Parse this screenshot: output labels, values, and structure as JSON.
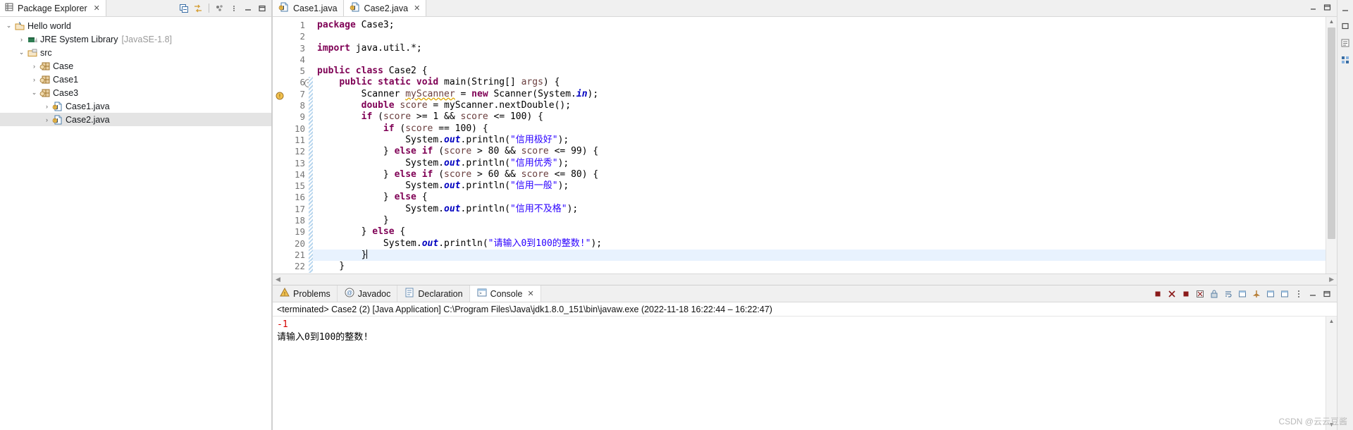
{
  "package_explorer": {
    "tab_label": "Package Explorer",
    "tab_close": "✕",
    "toolbar": {
      "collapse_all": "collapse-all-icon",
      "link_with_editor": "link-with-editor-icon",
      "view_menu": "view-menu-icon",
      "minimize": "minimize-icon",
      "maximize": "maximize-icon"
    },
    "tree": [
      {
        "label": "Hello world",
        "dim": "",
        "indent": 0,
        "twisty": "v",
        "icon": "java-project-icon",
        "selected": false
      },
      {
        "label": "JRE System Library",
        "dim": "[JavaSE-1.8]",
        "indent": 1,
        "twisty": ">",
        "icon": "library-icon",
        "selected": false
      },
      {
        "label": "src",
        "dim": "",
        "indent": 1,
        "twisty": "v",
        "icon": "source-folder-icon",
        "selected": false
      },
      {
        "label": "Case",
        "dim": "",
        "indent": 2,
        "twisty": ">",
        "icon": "package-icon",
        "selected": false
      },
      {
        "label": "Case1",
        "dim": "",
        "indent": 2,
        "twisty": ">",
        "icon": "package-icon",
        "selected": false
      },
      {
        "label": "Case3",
        "dim": "",
        "indent": 2,
        "twisty": "v",
        "icon": "package-icon",
        "selected": false
      },
      {
        "label": "Case1.java",
        "dim": "",
        "indent": 3,
        "twisty": ">",
        "icon": "java-file-icon",
        "selected": false
      },
      {
        "label": "Case2.java",
        "dim": "",
        "indent": 3,
        "twisty": ">",
        "icon": "java-file-icon",
        "selected": true
      }
    ]
  },
  "editor": {
    "tabs": [
      {
        "label": "Case1.java",
        "active": false,
        "close": ""
      },
      {
        "label": "Case2.java",
        "active": true,
        "close": "✕"
      }
    ],
    "lines": [
      {
        "n": 1,
        "fold": false,
        "mark": "",
        "changed": false,
        "highlight": false,
        "tokens": [
          {
            "t": "package ",
            "c": "kw"
          },
          {
            "t": "Case3;",
            "c": "plain"
          }
        ]
      },
      {
        "n": 2,
        "fold": false,
        "mark": "",
        "changed": false,
        "highlight": false,
        "tokens": []
      },
      {
        "n": 3,
        "fold": false,
        "mark": "",
        "changed": false,
        "highlight": false,
        "tokens": [
          {
            "t": "import ",
            "c": "kw"
          },
          {
            "t": "java.util.*;",
            "c": "plain"
          }
        ]
      },
      {
        "n": 4,
        "fold": false,
        "mark": "",
        "changed": false,
        "highlight": false,
        "tokens": []
      },
      {
        "n": 5,
        "fold": false,
        "mark": "",
        "changed": false,
        "highlight": false,
        "tokens": [
          {
            "t": "public class ",
            "c": "kw"
          },
          {
            "t": "Case2 {",
            "c": "plain"
          }
        ]
      },
      {
        "n": 6,
        "fold": true,
        "mark": "",
        "changed": true,
        "highlight": false,
        "tokens": [
          {
            "t": "    ",
            "c": "plain"
          },
          {
            "t": "public static void ",
            "c": "kw"
          },
          {
            "t": "main(String[] ",
            "c": "plain"
          },
          {
            "t": "args",
            "c": "loc"
          },
          {
            "t": ") {",
            "c": "plain"
          }
        ]
      },
      {
        "n": 7,
        "fold": false,
        "mark": "warning",
        "changed": true,
        "highlight": false,
        "tokens": [
          {
            "t": "        Scanner ",
            "c": "plain"
          },
          {
            "t": "myScanner",
            "c": "warnvar"
          },
          {
            "t": " = ",
            "c": "plain"
          },
          {
            "t": "new ",
            "c": "kw"
          },
          {
            "t": "Scanner(System.",
            "c": "plain"
          },
          {
            "t": "in",
            "c": "fld"
          },
          {
            "t": ");",
            "c": "plain"
          }
        ]
      },
      {
        "n": 8,
        "fold": false,
        "mark": "",
        "changed": true,
        "highlight": false,
        "tokens": [
          {
            "t": "        ",
            "c": "plain"
          },
          {
            "t": "double ",
            "c": "kw"
          },
          {
            "t": "score",
            "c": "loc"
          },
          {
            "t": " = myScanner.nextDouble();",
            "c": "plain"
          }
        ]
      },
      {
        "n": 9,
        "fold": false,
        "mark": "",
        "changed": true,
        "highlight": false,
        "tokens": [
          {
            "t": "        ",
            "c": "plain"
          },
          {
            "t": "if ",
            "c": "kw"
          },
          {
            "t": "(",
            "c": "plain"
          },
          {
            "t": "score",
            "c": "loc"
          },
          {
            "t": " >= 1 && ",
            "c": "plain"
          },
          {
            "t": "score",
            "c": "loc"
          },
          {
            "t": " <= 100) {",
            "c": "plain"
          }
        ]
      },
      {
        "n": 10,
        "fold": false,
        "mark": "",
        "changed": true,
        "highlight": false,
        "tokens": [
          {
            "t": "            ",
            "c": "plain"
          },
          {
            "t": "if ",
            "c": "kw"
          },
          {
            "t": "(",
            "c": "plain"
          },
          {
            "t": "score",
            "c": "loc"
          },
          {
            "t": " == 100) {",
            "c": "plain"
          }
        ]
      },
      {
        "n": 11,
        "fold": false,
        "mark": "",
        "changed": true,
        "highlight": false,
        "tokens": [
          {
            "t": "                System.",
            "c": "plain"
          },
          {
            "t": "out",
            "c": "fld"
          },
          {
            "t": ".println(",
            "c": "plain"
          },
          {
            "t": "\"信用极好\"",
            "c": "str"
          },
          {
            "t": ");",
            "c": "plain"
          }
        ]
      },
      {
        "n": 12,
        "fold": false,
        "mark": "",
        "changed": true,
        "highlight": false,
        "tokens": [
          {
            "t": "            } ",
            "c": "plain"
          },
          {
            "t": "else if ",
            "c": "kw"
          },
          {
            "t": "(",
            "c": "plain"
          },
          {
            "t": "score",
            "c": "loc"
          },
          {
            "t": " > 80 && ",
            "c": "plain"
          },
          {
            "t": "score",
            "c": "loc"
          },
          {
            "t": " <= 99) {",
            "c": "plain"
          }
        ]
      },
      {
        "n": 13,
        "fold": false,
        "mark": "",
        "changed": true,
        "highlight": false,
        "tokens": [
          {
            "t": "                System.",
            "c": "plain"
          },
          {
            "t": "out",
            "c": "fld"
          },
          {
            "t": ".println(",
            "c": "plain"
          },
          {
            "t": "\"信用优秀\"",
            "c": "str"
          },
          {
            "t": ");",
            "c": "plain"
          }
        ]
      },
      {
        "n": 14,
        "fold": false,
        "mark": "",
        "changed": true,
        "highlight": false,
        "tokens": [
          {
            "t": "            } ",
            "c": "plain"
          },
          {
            "t": "else if ",
            "c": "kw"
          },
          {
            "t": "(",
            "c": "plain"
          },
          {
            "t": "score",
            "c": "loc"
          },
          {
            "t": " > 60 && ",
            "c": "plain"
          },
          {
            "t": "score",
            "c": "loc"
          },
          {
            "t": " <= 80) {",
            "c": "plain"
          }
        ]
      },
      {
        "n": 15,
        "fold": false,
        "mark": "",
        "changed": true,
        "highlight": false,
        "tokens": [
          {
            "t": "                System.",
            "c": "plain"
          },
          {
            "t": "out",
            "c": "fld"
          },
          {
            "t": ".println(",
            "c": "plain"
          },
          {
            "t": "\"信用一般\"",
            "c": "str"
          },
          {
            "t": ");",
            "c": "plain"
          }
        ]
      },
      {
        "n": 16,
        "fold": false,
        "mark": "",
        "changed": true,
        "highlight": false,
        "tokens": [
          {
            "t": "            } ",
            "c": "plain"
          },
          {
            "t": "else ",
            "c": "kw"
          },
          {
            "t": "{",
            "c": "plain"
          }
        ]
      },
      {
        "n": 17,
        "fold": false,
        "mark": "",
        "changed": true,
        "highlight": false,
        "tokens": [
          {
            "t": "                System.",
            "c": "plain"
          },
          {
            "t": "out",
            "c": "fld"
          },
          {
            "t": ".println(",
            "c": "plain"
          },
          {
            "t": "\"信用不及格\"",
            "c": "str"
          },
          {
            "t": ");",
            "c": "plain"
          }
        ]
      },
      {
        "n": 18,
        "fold": false,
        "mark": "",
        "changed": true,
        "highlight": false,
        "tokens": [
          {
            "t": "            }",
            "c": "plain"
          }
        ]
      },
      {
        "n": 19,
        "fold": false,
        "mark": "",
        "changed": true,
        "highlight": false,
        "tokens": [
          {
            "t": "        } ",
            "c": "plain"
          },
          {
            "t": "else ",
            "c": "kw"
          },
          {
            "t": "{",
            "c": "plain"
          }
        ]
      },
      {
        "n": 20,
        "fold": false,
        "mark": "",
        "changed": true,
        "highlight": false,
        "tokens": [
          {
            "t": "            System.",
            "c": "plain"
          },
          {
            "t": "out",
            "c": "fld"
          },
          {
            "t": ".println(",
            "c": "plain"
          },
          {
            "t": "\"请输入0到100的整数!\"",
            "c": "str"
          },
          {
            "t": ");",
            "c": "plain"
          }
        ]
      },
      {
        "n": 21,
        "fold": false,
        "mark": "",
        "changed": true,
        "highlight": true,
        "tokens": [
          {
            "t": "        }",
            "c": "plain"
          }
        ]
      },
      {
        "n": 22,
        "fold": false,
        "mark": "",
        "changed": true,
        "highlight": false,
        "tokens": [
          {
            "t": "    }",
            "c": "plain"
          }
        ]
      }
    ]
  },
  "bottom": {
    "tabs": [
      {
        "label": "Problems",
        "icon": "problems-icon",
        "active": false,
        "close": ""
      },
      {
        "label": "Javadoc",
        "icon": "javadoc-icon",
        "active": false,
        "close": ""
      },
      {
        "label": "Declaration",
        "icon": "declaration-icon",
        "active": false,
        "close": ""
      },
      {
        "label": "Console",
        "icon": "console-icon",
        "active": true,
        "close": "✕"
      }
    ],
    "toolbar_icons": [
      "terminate-icon",
      "remove-launch-icon",
      "remove-all-terminated-icon",
      "clear-console-icon",
      "scroll-lock-icon",
      "word-wrap-icon",
      "show-console-on-output-icon",
      "pin-console-icon",
      "display-selected-console-icon",
      "open-console-icon",
      "view-menu-icon",
      "minimize-icon",
      "maximize-icon"
    ],
    "console_status": "<terminated> Case2 (2) [Java Application] C:\\Program Files\\Java\\jdk1.8.0_151\\bin\\javaw.exe  (2022-11-18 16:22:44 – 16:22:47)",
    "console_output": [
      {
        "text": "-1",
        "kind": "error"
      },
      {
        "text": "请输入0到100的整数!",
        "kind": "out"
      }
    ]
  },
  "watermark": "CSDN @云云豆酱",
  "colors": {
    "keyword": "#7f0055",
    "string": "#2a00ff",
    "field": "#0000c0",
    "local": "#6a3e3e",
    "error": "#d40000",
    "selection": "#e4e4e4",
    "current_line": "#e8f2fe"
  }
}
